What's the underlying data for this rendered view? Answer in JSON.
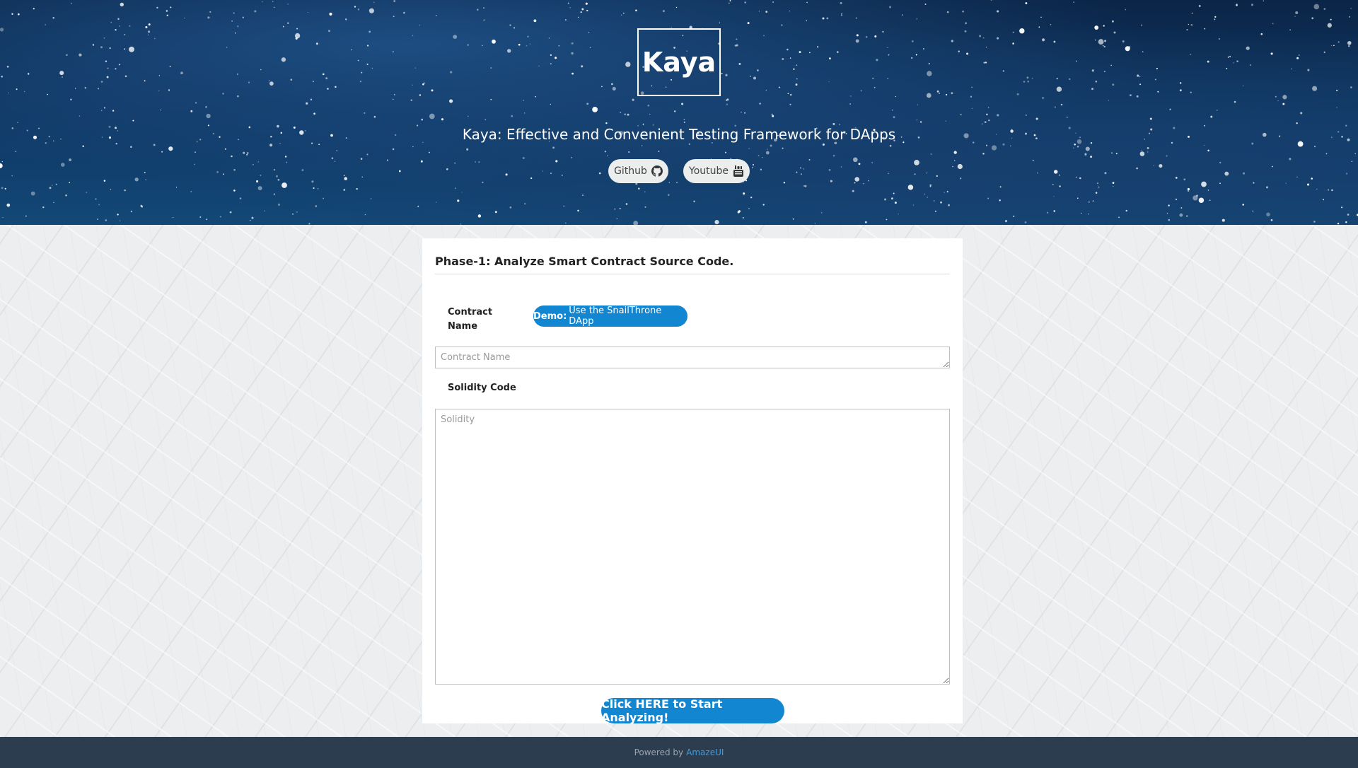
{
  "header": {
    "logo_text": "Kaya",
    "subtitle": "Kaya: Effective and Convenient Testing Framework for DApps",
    "links": [
      {
        "label": "Github",
        "icon": "github-icon"
      },
      {
        "label": "Youtube",
        "icon": "youtube-icon"
      }
    ]
  },
  "phase": {
    "title": "Phase-1: Analyze Smart Contract Source Code.",
    "contract_name_label": "Contract Name",
    "demo_button": {
      "bold": "Demo:",
      "text": "Use the SnailThrone DApp"
    },
    "contract_name_input": {
      "value": "",
      "placeholder": "Contract Name"
    },
    "solidity_label": "Solidity Code",
    "solidity_input": {
      "value": "",
      "placeholder": "Solidity"
    },
    "analyze_button": "Click HERE to Start Analyzing!"
  },
  "footer": {
    "prefix": "Powered by",
    "link": "AmazeUI"
  },
  "colors": {
    "accent": "#1286d1",
    "footer_bg": "#2d3d50",
    "hero_bg": "#0f3a67"
  }
}
